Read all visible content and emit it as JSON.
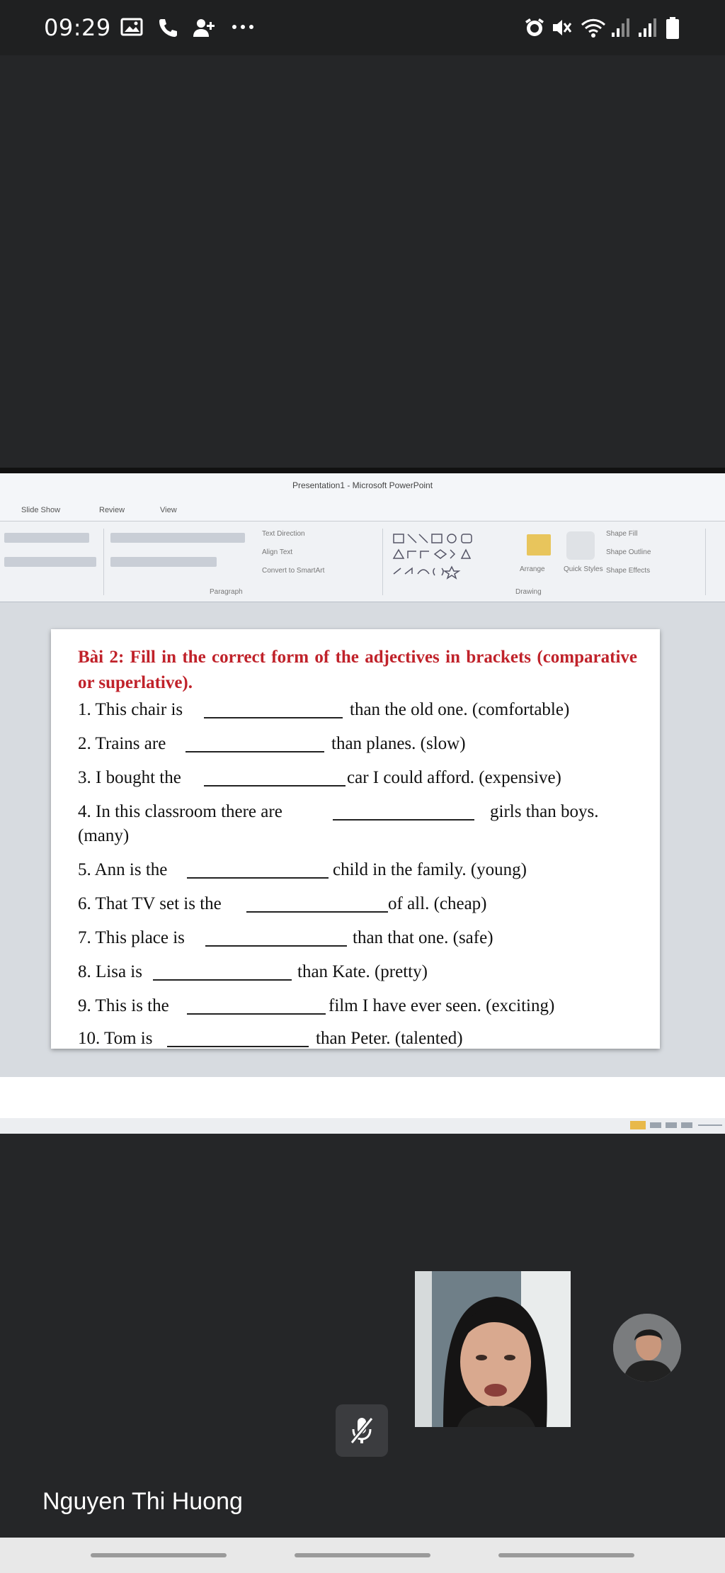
{
  "status_bar": {
    "time": "09:29",
    "left_icons": [
      "gallery-icon",
      "phone-icon",
      "add-contact-icon",
      "more-icon"
    ],
    "right_icons": [
      "alarm-icon",
      "mute-icon",
      "wifi-icon",
      "signal-icon",
      "signal-icon",
      "battery-icon"
    ]
  },
  "ppt": {
    "title": "Presentation1 - Microsoft PowerPoint",
    "tabs": [
      "Slide Show",
      "Review",
      "View"
    ],
    "ribbon": {
      "text_direction": "Text Direction",
      "align_text": "Align Text",
      "convert_smartart": "Convert to SmartArt",
      "paragraph_group": "Paragraph",
      "arrange": "Arrange",
      "quick_styles": "Quick Styles",
      "shape_fill": "Shape Fill",
      "shape_outline": "Shape Outline",
      "shape_effects": "Shape Effects",
      "drawing_group": "Drawing"
    }
  },
  "slide": {
    "heading": "Bài 2:  Fill in the correct form of the adjectives in brackets (comparative or superlative).",
    "exercises": [
      {
        "before": "1. This chair is",
        "after": "than the old one. (comfortable)"
      },
      {
        "before": "2. Trains are",
        "after": "than planes. (slow)"
      },
      {
        "before": "3. I bought the",
        "after": "car I could afford. (expensive)"
      },
      {
        "before": "4.  In this classroom there are",
        "after": "girls than boys.",
        "continuation": "(many)"
      },
      {
        "before": "5. Ann is the",
        "after": "child in the family. (young)"
      },
      {
        "before": "6. That TV set is the",
        "after": "of all. (cheap)"
      },
      {
        "before": "7. This place is",
        "after": "than that one. (safe)"
      },
      {
        "before": "8. Lisa is",
        "after": "than Kate. (pretty)"
      },
      {
        "before": "9. This is the",
        "after": "film I have ever seen. (exciting)"
      },
      {
        "before": "10. Tom is",
        "after": "than Peter. (talented)"
      }
    ]
  },
  "meeting": {
    "participant_name": "Nguyen Thi Huong",
    "mute_icon": "microphone-off-icon"
  },
  "nav": {
    "buttons": [
      "recent-apps",
      "home",
      "back"
    ]
  }
}
